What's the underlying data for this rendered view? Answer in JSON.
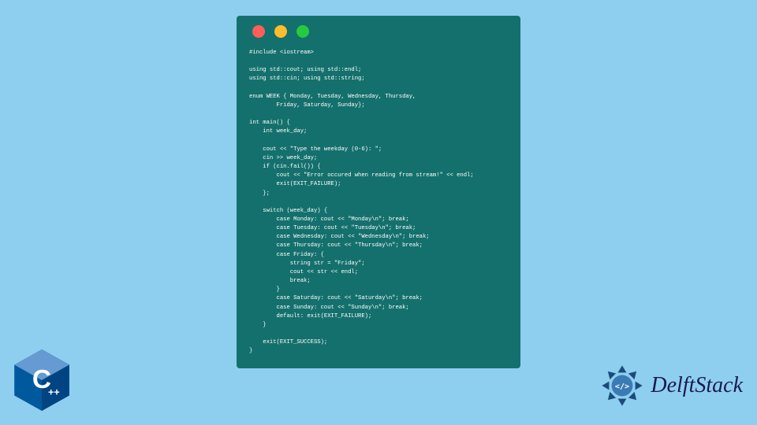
{
  "code_lines": [
    "#include <iostream>",
    "",
    "using std::cout; using std::endl;",
    "using std::cin; using std::string;",
    "",
    "enum WEEK { Monday, Tuesday, Wednesday, Thursday,",
    "        Friday, Saturday, Sunday};",
    "",
    "int main() {",
    "    int week_day;",
    "",
    "    cout << \"Type the weekday (0-6): \";",
    "    cin >> week_day;",
    "    if (cin.fail()) {",
    "        cout << \"Error occured when reading from stream!\" << endl;",
    "        exit(EXIT_FAILURE);",
    "    };",
    "",
    "    switch (week_day) {",
    "        case Monday: cout << \"Monday\\n\"; break;",
    "        case Tuesday: cout << \"Tuesday\\n\"; break;",
    "        case Wednesday: cout << \"Wednesday\\n\"; break;",
    "        case Thursday: cout << \"Thursday\\n\"; break;",
    "        case Friday: {",
    "            string str = \"Friday\";",
    "            cout << str << endl;",
    "            break;",
    "        }",
    "        case Saturday: cout << \"Saturday\\n\"; break;",
    "        case Sunday: cout << \"Sunday\\n\"; break;",
    "        default: exit(EXIT_FAILURE);",
    "    }",
    "",
    "    exit(EXIT_SUCCESS);",
    "}"
  ],
  "cpp_badge": {
    "text_main": "C",
    "text_plus": "++"
  },
  "brand": {
    "name": "DelftStack"
  },
  "colors": {
    "bg": "#8ecff0",
    "code_bg": "#14706d",
    "code_fg": "#ffffff",
    "cpp_blue": "#004482",
    "cpp_blue_light": "#00599c",
    "ds_blue": "#1a1a4d"
  }
}
